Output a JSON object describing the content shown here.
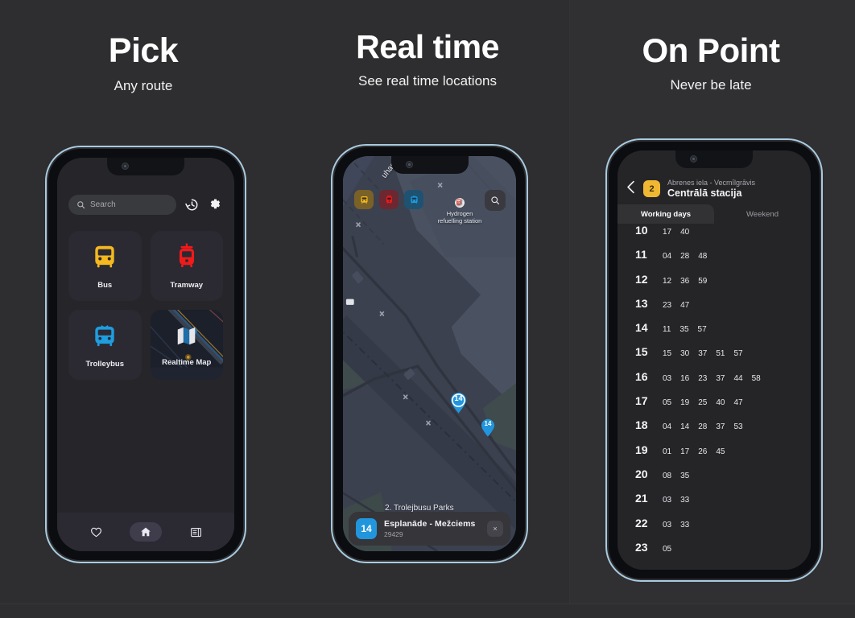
{
  "columns": [
    {
      "title": "Pick",
      "subtitle": "Any route"
    },
    {
      "title": "Real time",
      "subtitle": "See real time locations"
    },
    {
      "title": "On Point",
      "subtitle": "Never be late"
    }
  ],
  "phone_home": {
    "search": {
      "placeholder": "Search",
      "icon": "search-icon"
    },
    "history_icon": "history-icon",
    "settings_icon": "gear-icon",
    "tiles": [
      {
        "label": "Bus",
        "icon": "bus-icon",
        "color": "#f5b81f"
      },
      {
        "label": "Tramway",
        "icon": "tram-icon",
        "color": "#f01a1a"
      },
      {
        "label": "Trolleybus",
        "icon": "trolleybus-icon",
        "color": "#1e9de0"
      },
      {
        "label": "Realtime Map",
        "icon": "map-icon",
        "color": "#d8d8dd"
      }
    ],
    "nav": [
      {
        "name": "favourites",
        "icon": "heart-icon",
        "active": false
      },
      {
        "name": "home",
        "icon": "home-icon",
        "active": true
      },
      {
        "name": "news",
        "icon": "news-icon",
        "active": false
      }
    ]
  },
  "phone_map": {
    "filters": [
      {
        "label": "bus",
        "icon": "bus-icon",
        "color": "#7a6128"
      },
      {
        "label": "tram",
        "icon": "tram-icon",
        "color": "#6d2730"
      },
      {
        "label": "trolleybus",
        "icon": "trolleybus-icon",
        "color": "#1f5271"
      }
    ],
    "search_icon": "search-icon",
    "poi": {
      "label_line1": "Hydrogen",
      "label_line2": "refuelling station",
      "icon": "fuel-station-icon"
    },
    "street_label": "2. Trolejbusu Parks",
    "street_label_top": "uhas ga",
    "vehicles": [
      {
        "label": "14",
        "selected": true
      },
      {
        "label": "14",
        "selected": false
      }
    ],
    "card": {
      "badge": "14",
      "title": "Esplanāde - Mežciems",
      "subtitle": "29429",
      "close_label": "×",
      "accent": "#2196dd"
    }
  },
  "phone_timetable": {
    "back_icon": "chevron-left-icon",
    "line_number": "2",
    "direction": "Abrenes iela - Vecmīlgrāvis",
    "stop_name": "Centrālā stacija",
    "tabs": [
      {
        "label": "Working days",
        "active": true
      },
      {
        "label": "Weekend",
        "active": false
      }
    ],
    "rows": [
      {
        "hour": "10",
        "minutes": [
          "17",
          "40"
        ]
      },
      {
        "hour": "11",
        "minutes": [
          "04",
          "28",
          "48"
        ]
      },
      {
        "hour": "12",
        "minutes": [
          "12",
          "36",
          "59"
        ]
      },
      {
        "hour": "13",
        "minutes": [
          "23",
          "47"
        ]
      },
      {
        "hour": "14",
        "minutes": [
          "11",
          "35",
          "57"
        ]
      },
      {
        "hour": "15",
        "minutes": [
          "15",
          "30",
          "37",
          "51",
          "57"
        ]
      },
      {
        "hour": "16",
        "minutes": [
          "03",
          "16",
          "23",
          "37",
          "44",
          "58"
        ]
      },
      {
        "hour": "17",
        "minutes": [
          "05",
          "19",
          "25",
          "40",
          "47"
        ]
      },
      {
        "hour": "18",
        "minutes": [
          "04",
          "14",
          "28",
          "37",
          "53"
        ]
      },
      {
        "hour": "19",
        "minutes": [
          "01",
          "17",
          "26",
          "45"
        ]
      },
      {
        "hour": "20",
        "minutes": [
          "08",
          "35"
        ]
      },
      {
        "hour": "21",
        "minutes": [
          "03",
          "33"
        ]
      },
      {
        "hour": "22",
        "minutes": [
          "03",
          "33"
        ]
      },
      {
        "hour": "23",
        "minutes": [
          "05"
        ]
      }
    ]
  },
  "colors": {
    "background": "#2e2d2f",
    "phone_rim": "#a8cbe0",
    "accent_blue": "#2196dd",
    "accent_yellow": "#f0b832",
    "accent_red": "#f01a1a"
  }
}
